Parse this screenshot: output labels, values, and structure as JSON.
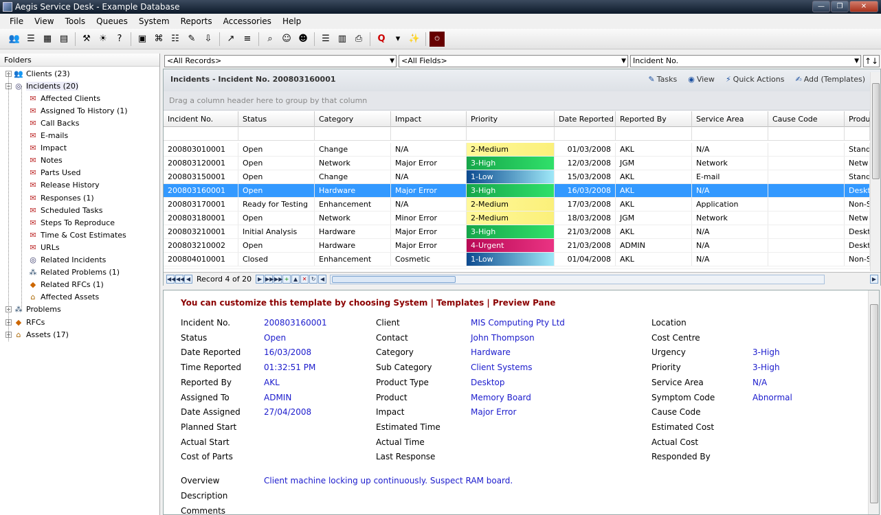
{
  "window": {
    "title": "Aegis Service Desk - Example Database"
  },
  "menu": [
    "File",
    "View",
    "Tools",
    "Queues",
    "System",
    "Reports",
    "Accessories",
    "Help"
  ],
  "toolbar_icons": [
    "clients-icon",
    "incidents-icon",
    "calendar-icon",
    "grid-icon",
    "sep",
    "tools-icon",
    "bulb-icon",
    "faq-icon",
    "sep",
    "window-icon",
    "network-icon",
    "document-icon",
    "edit-icon",
    "import-icon",
    "sep",
    "chart-icon",
    "tree-icon",
    "sep",
    "search-icon",
    "people-icon",
    "person-icon",
    "sep",
    "list-icon",
    "report-icon",
    "print-icon",
    "sep",
    "q-icon",
    "dropdown-icon",
    "wand-icon",
    "sep",
    "exit-icon"
  ],
  "folders": {
    "header": "Folders",
    "items": [
      {
        "label": "Clients (23)",
        "level": 0,
        "icon": "clients-icon",
        "exp": "+"
      },
      {
        "label": "Incidents (20)",
        "level": 0,
        "icon": "incidents-icon",
        "exp": "−",
        "selected": true
      },
      {
        "label": "Affected Clients",
        "level": 1,
        "icon": "folder-icon"
      },
      {
        "label": "Assigned To History (1)",
        "level": 1,
        "icon": "folder-icon"
      },
      {
        "label": "Call Backs",
        "level": 1,
        "icon": "folder-icon"
      },
      {
        "label": "E-mails",
        "level": 1,
        "icon": "folder-icon"
      },
      {
        "label": "Impact",
        "level": 1,
        "icon": "folder-icon"
      },
      {
        "label": "Notes",
        "level": 1,
        "icon": "folder-icon"
      },
      {
        "label": "Parts Used",
        "level": 1,
        "icon": "folder-icon"
      },
      {
        "label": "Release History",
        "level": 1,
        "icon": "folder-icon"
      },
      {
        "label": "Responses (1)",
        "level": 1,
        "icon": "folder-icon"
      },
      {
        "label": "Scheduled Tasks",
        "level": 1,
        "icon": "folder-icon"
      },
      {
        "label": "Steps To Reproduce",
        "level": 1,
        "icon": "folder-icon"
      },
      {
        "label": "Time & Cost Estimates",
        "level": 1,
        "icon": "folder-icon"
      },
      {
        "label": "URLs",
        "level": 1,
        "icon": "folder-icon"
      },
      {
        "label": "Related Incidents",
        "level": 1,
        "icon": "incidents-icon"
      },
      {
        "label": "Related Problems (1)",
        "level": 1,
        "icon": "problems-icon"
      },
      {
        "label": "Related RFCs (1)",
        "level": 1,
        "icon": "rfc-icon"
      },
      {
        "label": "Affected Assets",
        "level": 1,
        "icon": "assets-icon"
      },
      {
        "label": "Problems",
        "level": 0,
        "icon": "problems-icon",
        "exp": "+"
      },
      {
        "label": "RFCs",
        "level": 0,
        "icon": "rfc-icon",
        "exp": "+"
      },
      {
        "label": "Assets (17)",
        "level": 0,
        "icon": "assets-icon",
        "exp": "+"
      }
    ]
  },
  "filters": {
    "records": "<All Records>",
    "fields": "<All Fields>",
    "sort": "Incident No."
  },
  "grid": {
    "title": "Incidents - Incident No. 200803160001",
    "actions": [
      {
        "label": "Tasks",
        "icon": "tasks-icon"
      },
      {
        "label": "View",
        "icon": "view-icon"
      },
      {
        "label": "Quick Actions",
        "icon": "quick-actions-icon"
      },
      {
        "label": "Add (Templates)",
        "icon": "add-icon"
      }
    ],
    "group_hint": "Drag a column header here to group by that column",
    "columns": [
      "Incident No.",
      "Status",
      "Category",
      "Impact",
      "Priority",
      "Date Reported",
      "Reported By",
      "Service Area",
      "Cause Code",
      "Produ"
    ],
    "rows": [
      [
        "200803010001",
        "Open",
        "Change",
        "N/A",
        "2-Medium",
        "01/03/2008",
        "AKL",
        "N/A",
        "",
        "Stand"
      ],
      [
        "200803120001",
        "Open",
        "Network",
        "Major Error",
        "3-High",
        "12/03/2008",
        "JGM",
        "Network",
        "",
        "Netw"
      ],
      [
        "200803150001",
        "Open",
        "Change",
        "N/A",
        "1-Low",
        "15/03/2008",
        "AKL",
        "E-mail",
        "",
        "Stand"
      ],
      [
        "200803160001",
        "Open",
        "Hardware",
        "Major Error",
        "3-High",
        "16/03/2008",
        "AKL",
        "N/A",
        "",
        "Deskt"
      ],
      [
        "200803170001",
        "Ready for Testing",
        "Enhancement",
        "N/A",
        "2-Medium",
        "17/03/2008",
        "AKL",
        "Application",
        "",
        "Non-S"
      ],
      [
        "200803180001",
        "Open",
        "Network",
        "Minor Error",
        "2-Medium",
        "18/03/2008",
        "JGM",
        "Network",
        "",
        "Netw"
      ],
      [
        "200803210001",
        "Initial Analysis",
        "Hardware",
        "Major Error",
        "3-High",
        "21/03/2008",
        "AKL",
        "N/A",
        "",
        "Deskt"
      ],
      [
        "200803210002",
        "Open",
        "Hardware",
        "Major Error",
        "4-Urgent",
        "21/03/2008",
        "ADMIN",
        "N/A",
        "",
        "Deskt"
      ],
      [
        "200804010001",
        "Closed",
        "Enhancement",
        "Cosmetic",
        "1-Low",
        "01/04/2008",
        "AKL",
        "N/A",
        "",
        "Non-S"
      ]
    ],
    "selected_row": 3,
    "record_text": "Record 4 of 20"
  },
  "preview": {
    "title": "You can customize this template by choosing System | Templates | Preview Pane",
    "col1": [
      {
        "label": "Incident No.",
        "value": "200803160001"
      },
      {
        "label": "Status",
        "value": "Open"
      },
      {
        "label": "Date Reported",
        "value": "16/03/2008"
      },
      {
        "label": "Time Reported",
        "value": "01:32:51 PM"
      },
      {
        "label": "Reported By",
        "value": "AKL"
      },
      {
        "label": "Assigned To",
        "value": "ADMIN"
      },
      {
        "label": "Date Assigned",
        "value": "27/04/2008"
      },
      {
        "label": "Planned Start",
        "value": ""
      },
      {
        "label": "Actual Start",
        "value": ""
      },
      {
        "label": "Cost of Parts",
        "value": ""
      }
    ],
    "col2": [
      {
        "label": "Client",
        "value": "MIS Computing Pty Ltd"
      },
      {
        "label": "Contact",
        "value": "John Thompson"
      },
      {
        "label": "Category",
        "value": "Hardware"
      },
      {
        "label": "Sub Category",
        "value": "Client Systems"
      },
      {
        "label": "Product Type",
        "value": "Desktop"
      },
      {
        "label": "Product",
        "value": "Memory Board"
      },
      {
        "label": "Impact",
        "value": "Major Error"
      },
      {
        "label": "Estimated Time",
        "value": ""
      },
      {
        "label": "Actual Time",
        "value": ""
      },
      {
        "label": "Last Response",
        "value": ""
      }
    ],
    "col3": [
      {
        "label": "Location",
        "value": ""
      },
      {
        "label": "Cost Centre",
        "value": ""
      },
      {
        "label": "Urgency",
        "value": "3-High"
      },
      {
        "label": "Priority",
        "value": "3-High"
      },
      {
        "label": "Service Area",
        "value": "N/A"
      },
      {
        "label": "Symptom Code",
        "value": "Abnormal"
      },
      {
        "label": "Cause Code",
        "value": ""
      },
      {
        "label": "Estimated Cost",
        "value": ""
      },
      {
        "label": "Actual Cost",
        "value": ""
      },
      {
        "label": "Responded By",
        "value": ""
      }
    ],
    "bottom": [
      {
        "label": "Overview",
        "value": "Client machine locking up continuously. Suspect RAM board."
      },
      {
        "label": "Description",
        "value": ""
      },
      {
        "label": "Comments",
        "value": ""
      }
    ]
  }
}
